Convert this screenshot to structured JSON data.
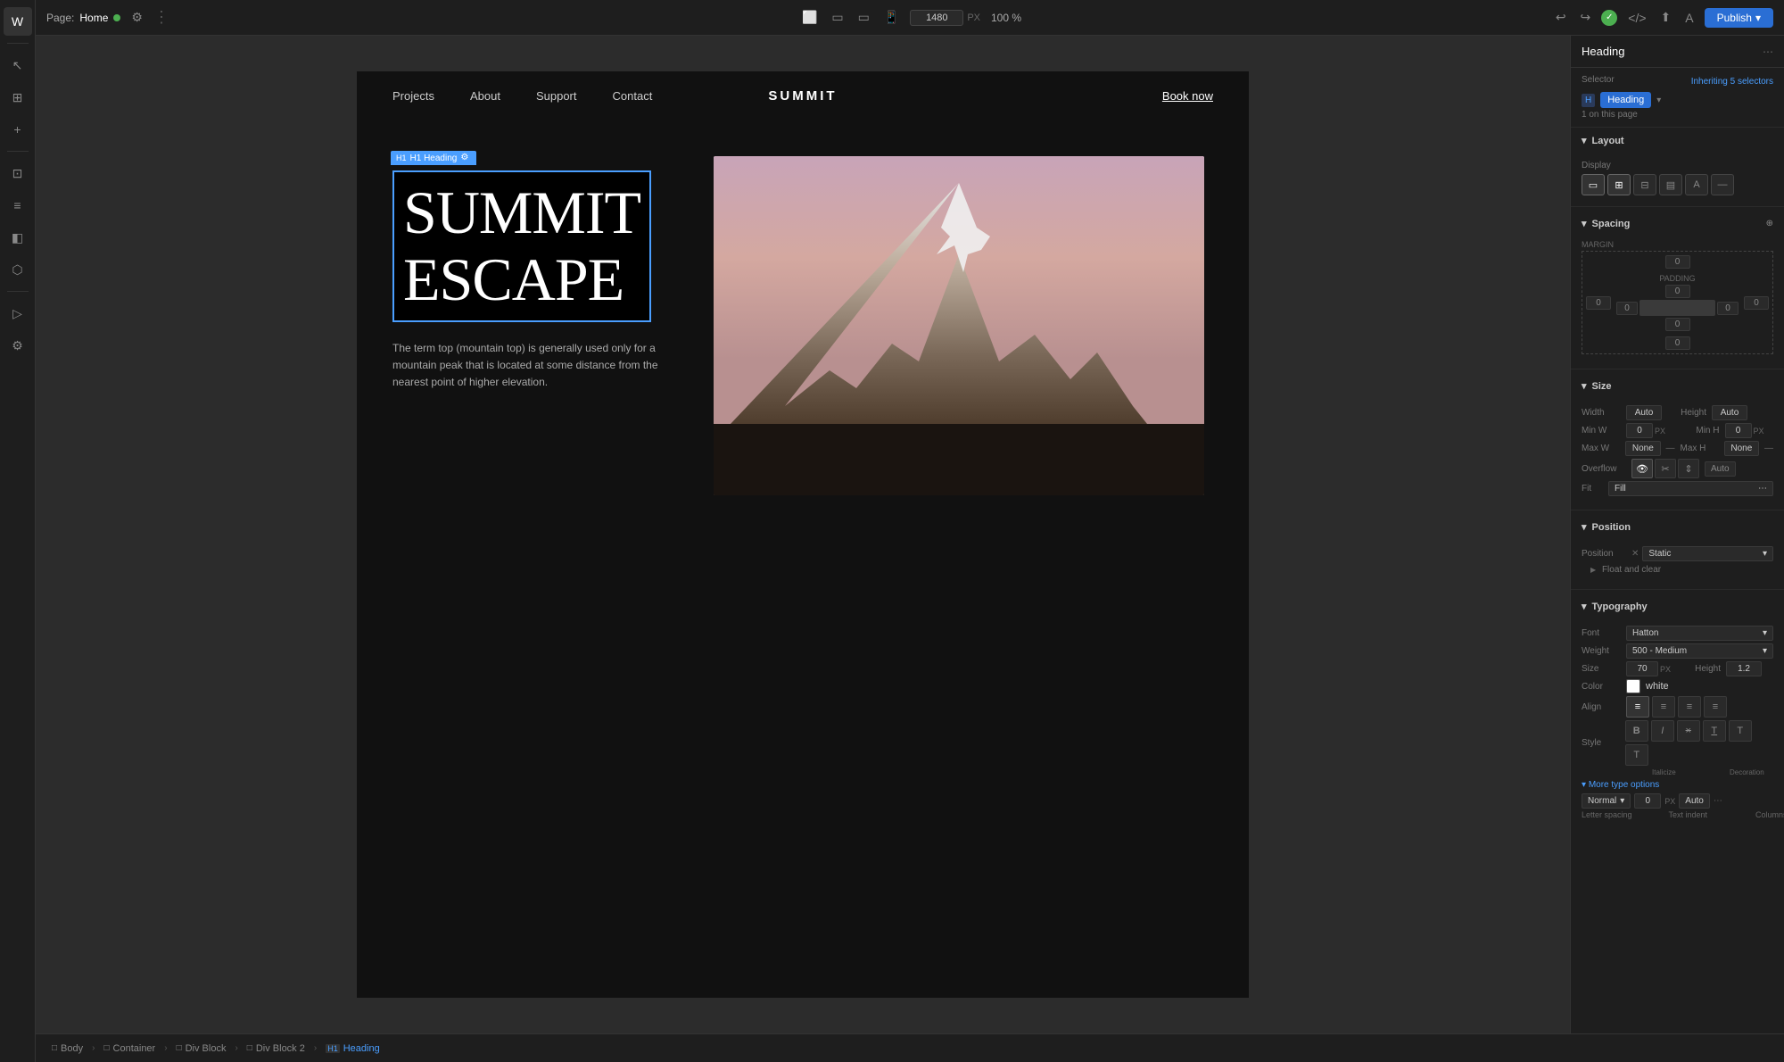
{
  "app": {
    "page_label": "Page:",
    "page_name": "Home",
    "viewport_width": "1480",
    "viewport_unit": "PX",
    "zoom": "100",
    "zoom_unit": "%",
    "publish_label": "Publish"
  },
  "nav": {
    "links": [
      "Projects",
      "About",
      "Support",
      "Contact"
    ],
    "logo": "SUMMIT",
    "book_now": "Book now"
  },
  "content": {
    "heading_label": "H1 Heading",
    "heading_text_line1": "SUMMIT",
    "heading_text_line2": "ESCAPE",
    "description": "The term top (mountain top) is generally used only for a mountain peak that is located at some distance from the nearest point of higher elevation."
  },
  "breadcrumb": {
    "items": [
      {
        "icon": "□",
        "label": "Body"
      },
      {
        "icon": "□",
        "label": "Container"
      },
      {
        "icon": "□",
        "label": "Div Block"
      },
      {
        "icon": "□",
        "label": "Div Block 2"
      },
      {
        "icon": "H1",
        "label": "Heading"
      }
    ]
  },
  "right_panel": {
    "title": "Heading",
    "selector_label": "Selector",
    "inheriting_text": "Inheriting 5 selectors",
    "selector_name": "Heading",
    "on_page": "1 on this page",
    "layout": {
      "title": "Layout",
      "display_label": "Display",
      "display_options": [
        "block",
        "flex",
        "grid",
        "inline",
        "align-left",
        "none"
      ]
    },
    "spacing": {
      "title": "Spacing",
      "margin_label": "MARGIN",
      "margin_top": "0",
      "margin_right": "0",
      "margin_bottom": "0",
      "margin_left": "0",
      "padding_label": "PADDING",
      "padding_top": "0",
      "padding_right": "0",
      "padding_bottom": "0",
      "padding_left": "0"
    },
    "size": {
      "title": "Size",
      "width_label": "Width",
      "width_value": "Auto",
      "height_label": "Height",
      "height_value": "Auto",
      "min_w_label": "Min W",
      "min_w_value": "0",
      "min_w_unit": "PX",
      "min_h_label": "Min H",
      "min_h_value": "0",
      "min_h_unit": "PX",
      "max_w_label": "Max W",
      "max_w_value": "None",
      "max_h_label": "Max H",
      "max_h_value": "None",
      "overflow_label": "Overflow",
      "overflow_auto": "Auto",
      "fit_label": "Fit",
      "fit_value": "Fill"
    },
    "position": {
      "title": "Position",
      "position_label": "Position",
      "position_value": "Static",
      "float_clear": "Float and clear"
    },
    "typography": {
      "title": "Typography",
      "font_label": "Font",
      "font_value": "Hatton",
      "weight_label": "Weight",
      "weight_value": "500 - Medium",
      "size_label": "Size",
      "size_value": "70",
      "size_unit": "PX",
      "height_label": "Height",
      "height_value": "1.2",
      "color_label": "Color",
      "color_value": "white",
      "color_hex": "#ffffff",
      "align_label": "Align",
      "style_label": "Style",
      "style_options": [
        "B",
        "I",
        "×",
        "T̲",
        "T",
        "T"
      ],
      "style_labels": [
        "",
        "Italicize",
        "",
        "",
        "Decoration",
        ""
      ],
      "more_type_options": "More type options",
      "normal_value": "Normal",
      "normal_spacing": "0",
      "normal_unit": "PX",
      "normal_indent": "Auto",
      "letter_spacing": "Letter spacing",
      "text_indent": "Text indent",
      "columns": "Columns"
    }
  }
}
